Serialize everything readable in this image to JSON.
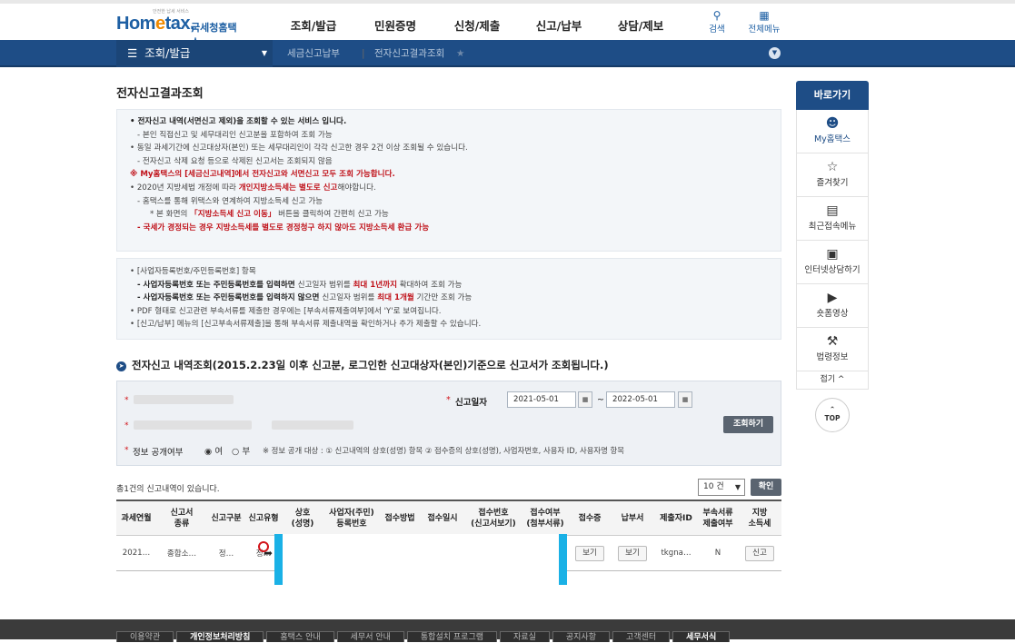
{
  "header": {
    "logo_small": "안전한 납세 서비스",
    "logo_main_1": "Hom",
    "logo_main_e": "e",
    "logo_main_2": "tax,",
    "logo_sub": "국세청홈택스",
    "nav": [
      "조회/발급",
      "민원증명",
      "신청/제출",
      "신고/납부",
      "상담/제보"
    ],
    "search_label": "검색",
    "allmenu_label": "전체메뉴"
  },
  "subnav": {
    "menu": "조회/발급",
    "crumb1": "세금신고납부",
    "crumb2": "전자신고결과조회"
  },
  "page_title": "전자신고결과조회",
  "notice1": {
    "l1": "전자신고 내역(서면신고 제외)을 조회할 수 있는 서비스 입니다.",
    "l2": "- 본인 직접신고 및 세무대리인 신고분을 포함하여 조회 가능",
    "l3": "동일 과세기간에 신고대상자(본인) 또는 세무대리인이 각각 신고한 경우 2건 이상 조회될 수 있습니다.",
    "l4": "- 전자신고 삭제 요청 등으로 삭제된 신고서는 조회되지 않음",
    "l5": "※ My홈택스의 [세금신고내역]에서 전자신고와 서면신고 모두 조회 가능합니다.",
    "l6a": "2020년 지방세법 개정에 따라 ",
    "l6b": "개인지방소득세는 별도로 신고",
    "l6c": "해야합니다.",
    "l7": "- 홈택스를 통해 위택스와 연계하여 지방소득세 신고 가능",
    "l8a": "* 본 화면의 ",
    "l8b": "「지방소득세 신고 이동」",
    "l8c": " 버튼을 클릭하여 간편히 신고 가능",
    "l9": "- 국세가 경정되는 경우 지방소득세를 별도로 경정청구 하지 않아도 지방소득세 환급 가능"
  },
  "notice2": {
    "l1": "[사업자등록번호/주민등록번호] 항목",
    "l2a": "- 사업자등록번호 또는 주민등록번호를 입력하면 ",
    "l2b": "신고일자 범위를 ",
    "l2c": "최대 1년까지",
    "l2d": " 확대하여 조회 가능",
    "l3a": "- 사업자등록번호 또는 주민등록번호를 입력하지 않으면 ",
    "l3b": "신고일자 범위를 ",
    "l3c": "최대 1개월",
    "l3d": " 기간만 조회 가능",
    "l4": "PDF 형태로 신고관련 부속서류를 제출한 경우에는 [부속서류제출여부]에서 'Y'로 보여집니다.",
    "l5": "[신고/납부] 메뉴의 [신고부속서류제출]을 통해 부속서류 제출내역을 확인하거나 추가 제출할 수 있습니다."
  },
  "section_title": "전자신고 내역조회(2015.2.23일 이후 신고분, 로그인한  신고대상자(본인)기준으로  신고서가 조회됩니다.)",
  "form": {
    "date_label": "신고일자",
    "date_from": "2021-05-01",
    "date_to": "2022-05-01",
    "tilde": "~",
    "query_button": "조회하기",
    "info_label": "정보 공개여부",
    "radio_yes": "여",
    "radio_no": "부",
    "info_note": "※ 정보 공개 대상 : ① 신고내역의 상호(성명) 항목 ② 접수증의 상호(성명), 사업자번호, 사용자 ID, 사용자명 항목"
  },
  "result": {
    "count_text": "총1건의 신고내역이 있습니다.",
    "page_size": "10 건",
    "confirm": "확인"
  },
  "table": {
    "headers": [
      "과세연월",
      "신고서\n종류",
      "신고구분",
      "신고유형",
      "상호\n(성명)",
      "사업자(주민)\n등록번호",
      "접수방법",
      "접수일시",
      "접수번호\n(신고서보기)",
      "접수여부\n(첨부서류)",
      "접수증",
      "납부서",
      "제출자ID",
      "부속서류\n제출여부",
      "지방\n소득세"
    ],
    "row": {
      "period": "2021…",
      "type": "종합소…",
      "gubun": "정…",
      "yuhyung": "정…",
      "receipt": "보기",
      "payment": "보기",
      "submitter": "tkgna…",
      "attach": "N",
      "local": "신고"
    }
  },
  "sidebar": {
    "header": "바로가기",
    "items": [
      {
        "label": "My홈택스",
        "icon": "person-icon"
      },
      {
        "label": "즐겨찾기",
        "icon": "star-icon"
      },
      {
        "label": "최근접속메뉴",
        "icon": "recent-icon"
      },
      {
        "label": "인터넷상담하기",
        "icon": "chat-icon"
      },
      {
        "label": "숏폼영상",
        "icon": "play-icon"
      },
      {
        "label": "법령정보",
        "icon": "gavel-icon"
      }
    ],
    "fold": "접기 ^",
    "top": "TOP"
  },
  "footer": {
    "links": [
      "이용약관",
      "개인정보처리방침",
      "홈택스 안내",
      "세무서 안내",
      "통합설치 프로그램",
      "자료실",
      "공지사항",
      "고객센터",
      "세무서식"
    ]
  },
  "colors": {
    "primary": "#1e4d86",
    "accent": "#c0121a",
    "logo_orange": "#f08a00",
    "popup_border": "#1ab1e6"
  }
}
